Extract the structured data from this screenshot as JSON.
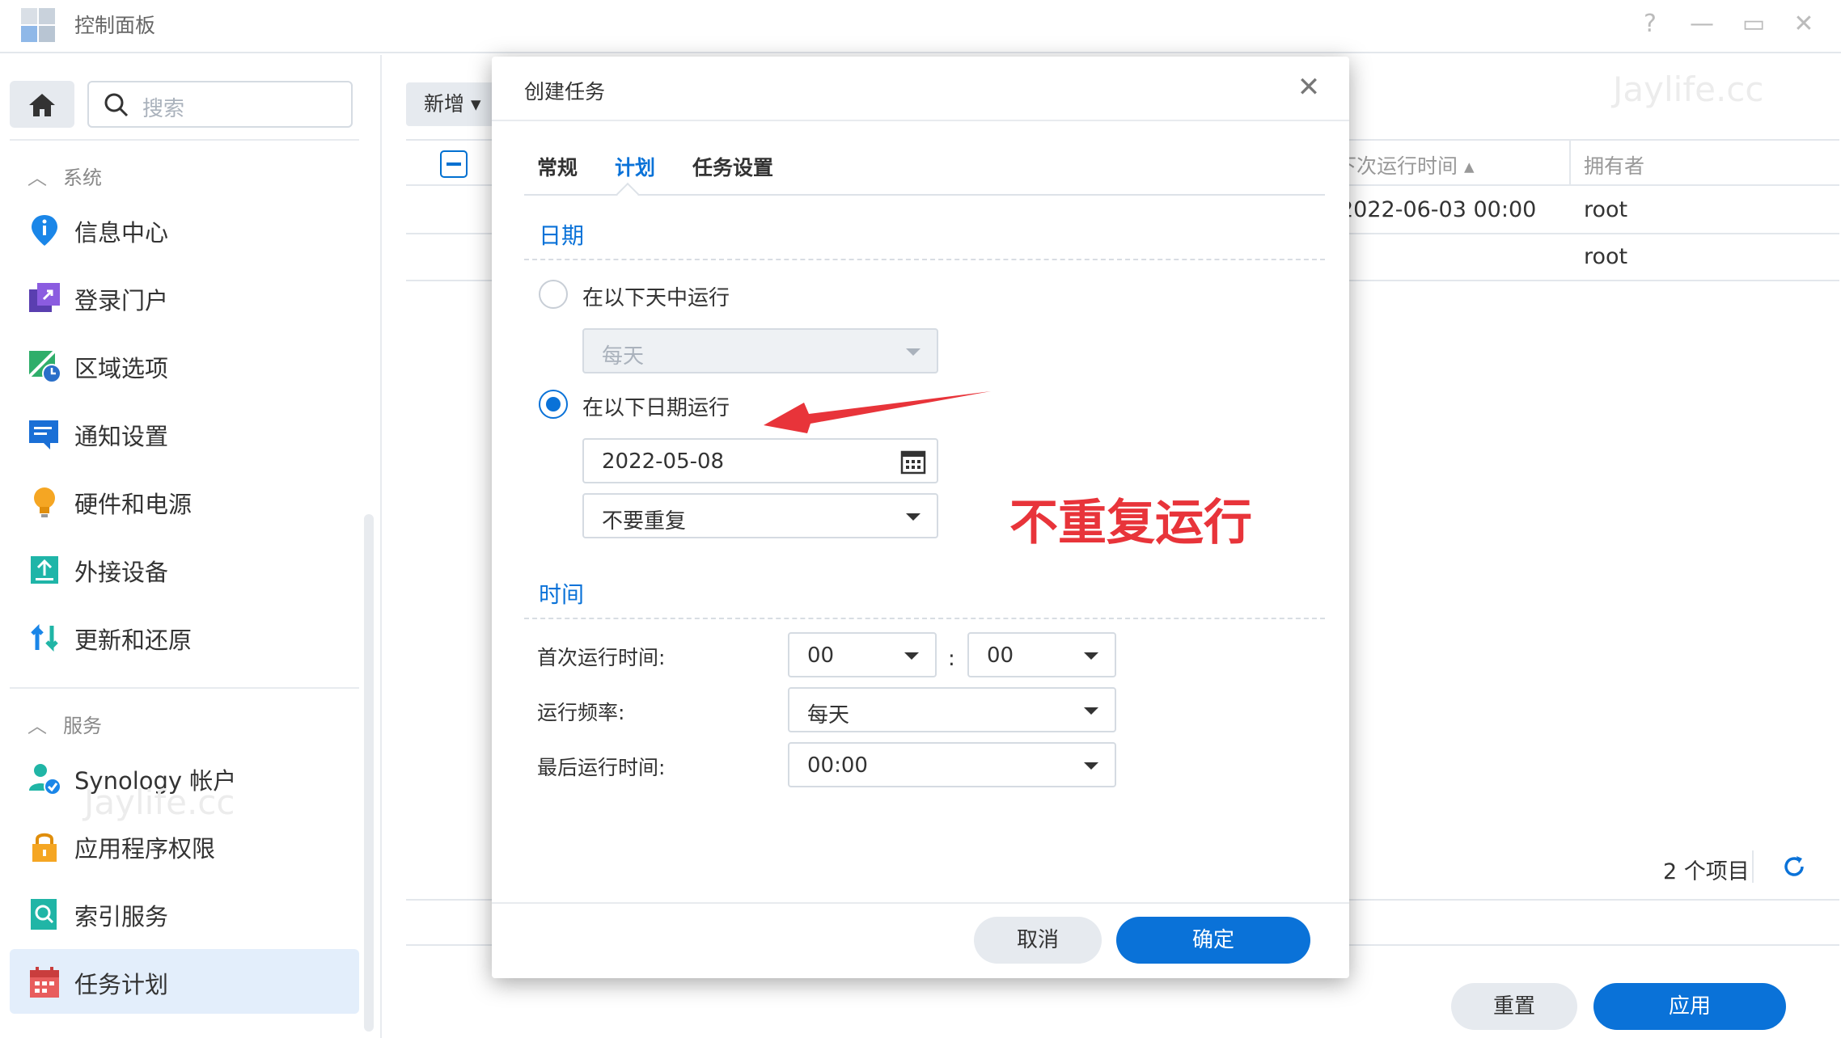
{
  "window": {
    "title": "控制面板",
    "help": "?",
    "minimize": "—",
    "maximize": "▭",
    "close": "✕"
  },
  "sidebar": {
    "search_placeholder": "搜索",
    "sections": [
      {
        "title": "系统",
        "items": [
          {
            "label": "信息中心",
            "icon": "info-icon"
          },
          {
            "label": "登录门户",
            "icon": "login-portal-icon"
          },
          {
            "label": "区域选项",
            "icon": "regional-options-icon"
          },
          {
            "label": "通知设置",
            "icon": "notification-icon"
          },
          {
            "label": "硬件和电源",
            "icon": "bulb-icon"
          },
          {
            "label": "外接设备",
            "icon": "external-device-icon"
          },
          {
            "label": "更新和还原",
            "icon": "update-restore-icon"
          }
        ]
      },
      {
        "title": "服务",
        "items": [
          {
            "label": "Synology 帐户",
            "icon": "synology-account-icon"
          },
          {
            "label": "应用程序权限",
            "icon": "lock-icon"
          },
          {
            "label": "索引服务",
            "icon": "index-service-icon"
          },
          {
            "label": "任务计划",
            "icon": "calendar-icon",
            "active": true
          }
        ]
      }
    ]
  },
  "main": {
    "new_button": "新增",
    "columns": {
      "next_run": "下次运行时间",
      "owner": "拥有者"
    },
    "rows": [
      {
        "next_run": "2022-06-03 00:00",
        "owner": "root"
      },
      {
        "next_run": "",
        "owner": "root"
      }
    ],
    "item_count": "2 个项目",
    "reset_button": "重置",
    "apply_button": "应用",
    "watermark": "Jaylife.cc"
  },
  "modal": {
    "title": "创建任务",
    "tabs": [
      "常规",
      "计划",
      "任务设置"
    ],
    "active_tab": "计划",
    "date_section": "日期",
    "radio_days": "在以下天中运行",
    "days_select": "每天",
    "radio_date": "在以下日期运行",
    "date_value": "2022-05-08",
    "repeat_select": "不要重复",
    "time_section": "时间",
    "first_run_label": "首次运行时间:",
    "first_run_hour": "00",
    "first_run_minute": "00",
    "frequency_label": "运行频率:",
    "frequency_value": "每天",
    "last_run_label": "最后运行时间:",
    "last_run_value": "00:00",
    "cancel_button": "取消",
    "ok_button": "确定"
  },
  "annotation": {
    "text": "不重复运行",
    "color": "#e8343a"
  },
  "colors": {
    "accent": "#0a72d8",
    "annotation": "#e8343a"
  }
}
